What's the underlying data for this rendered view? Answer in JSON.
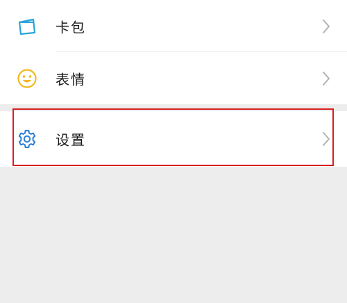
{
  "menu": {
    "items": [
      {
        "label": "卡包",
        "icon": "card-wallet-icon",
        "icon_color": "#2aa3d8"
      },
      {
        "label": "表情",
        "icon": "smiley-face-icon",
        "icon_color": "#f2b820"
      },
      {
        "label": "设置",
        "icon": "gear-icon",
        "icon_color": "#2a7fd4"
      }
    ]
  },
  "colors": {
    "background": "#ededed",
    "card": "#ffffff",
    "highlight_border": "#d81e1e",
    "chevron": "#b2b2b2"
  }
}
